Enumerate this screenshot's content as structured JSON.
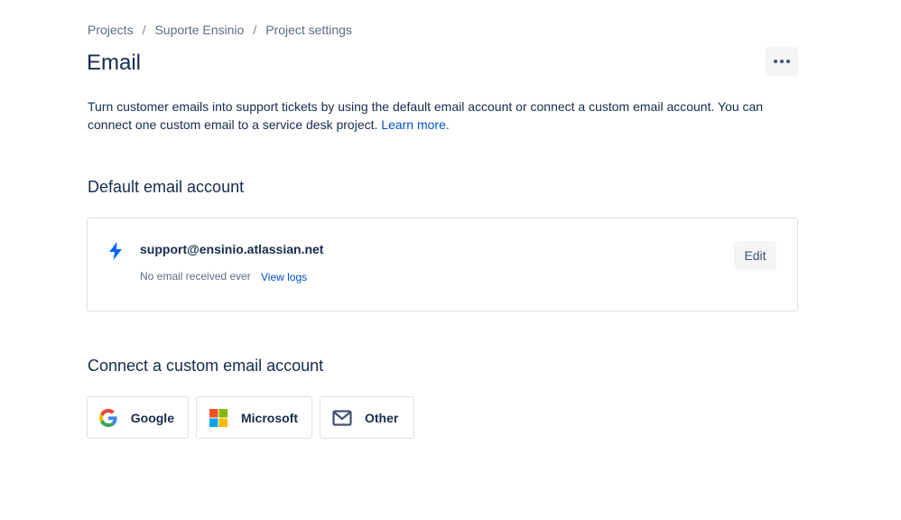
{
  "breadcrumb": {
    "items": [
      "Projects",
      "Suporte Ensinio",
      "Project settings"
    ],
    "separator": "/"
  },
  "page": {
    "title": "Email",
    "intro_text": "Turn customer emails into support tickets by using the default email account or connect a custom email account. You can connect one custom email to a service desk project.",
    "learn_more": "Learn more."
  },
  "default_account": {
    "heading": "Default email account",
    "email": "support@ensinio.atlassian.net",
    "status": "No email received ever",
    "view_logs": "View logs",
    "edit_label": "Edit",
    "icon": "bolt-icon"
  },
  "custom_account": {
    "heading": "Connect a custom email account",
    "providers": [
      {
        "label": "Google",
        "icon": "google-icon"
      },
      {
        "label": "Microsoft",
        "icon": "microsoft-icon"
      },
      {
        "label": "Other",
        "icon": "mail-icon"
      }
    ]
  },
  "colors": {
    "text": "#172b4d",
    "subtle_text": "#5e6c84",
    "link": "#0052cc",
    "bolt": "#0065ff",
    "border": "#dfe1e6",
    "button_bg": "#f4f5f7"
  }
}
